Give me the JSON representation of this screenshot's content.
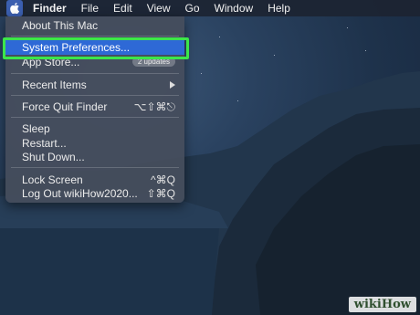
{
  "menubar": {
    "apple_icon": "apple-icon",
    "items": [
      "Finder",
      "File",
      "Edit",
      "View",
      "Go",
      "Window",
      "Help"
    ]
  },
  "apple_menu": {
    "about": "About This Mac",
    "system_preferences": "System Preferences...",
    "app_store": "App Store...",
    "app_store_badge": "2 updates",
    "recent_items": "Recent Items",
    "force_quit": "Force Quit Finder",
    "force_quit_shortcut": "⌥⇧⌘⎋",
    "sleep": "Sleep",
    "restart": "Restart...",
    "shut_down": "Shut Down...",
    "lock_screen": "Lock Screen",
    "lock_screen_shortcut": "^⌘Q",
    "log_out": "Log Out wikiHow2020...",
    "log_out_shortcut": "⇧⌘Q"
  },
  "colors": {
    "selection": "#2e69d6",
    "highlight_box": "#3ce64a"
  },
  "watermark": {
    "text": "wikiHow"
  }
}
